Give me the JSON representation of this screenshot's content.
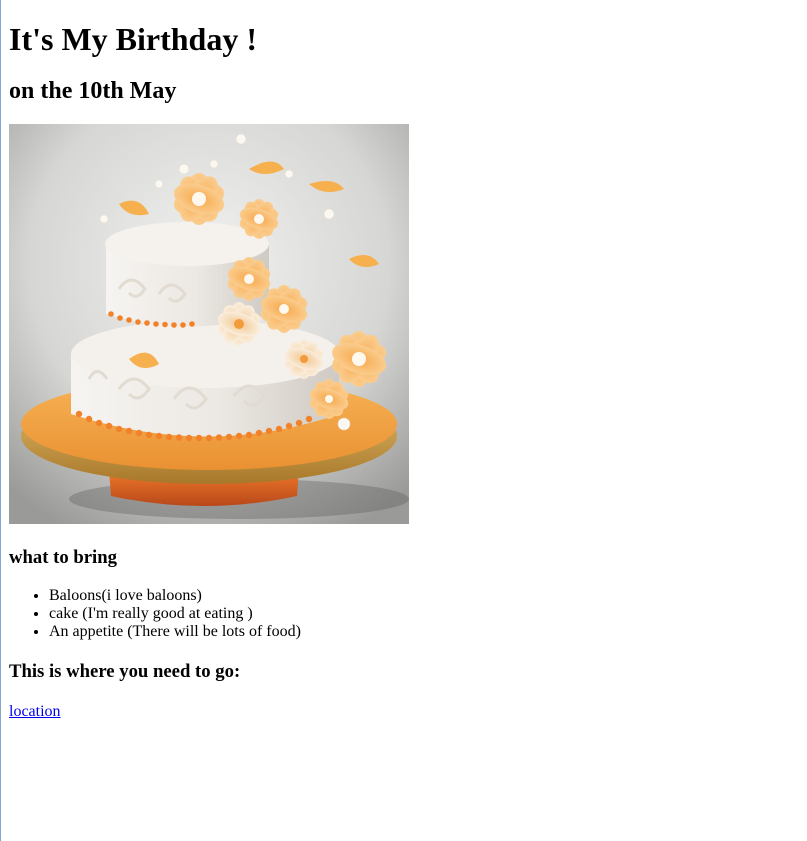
{
  "page": {
    "title": "It's My Birthday !",
    "subtitle": "on the 10th May",
    "image": {
      "alt": "",
      "subject": "two-tier white cake with orange flowers on a gold stand"
    },
    "bring_heading": "what to bring",
    "bring_items": [
      "Baloons(i love baloons)",
      "cake (I'm really good at eating )",
      "An appetite (There will be lots of food)"
    ],
    "go_heading": "This is where you need to go:",
    "location_link": "location"
  },
  "colors": {
    "link": "#0000ee",
    "accent_orange": "#f39a3c",
    "stand_gold": "#d9a441"
  }
}
